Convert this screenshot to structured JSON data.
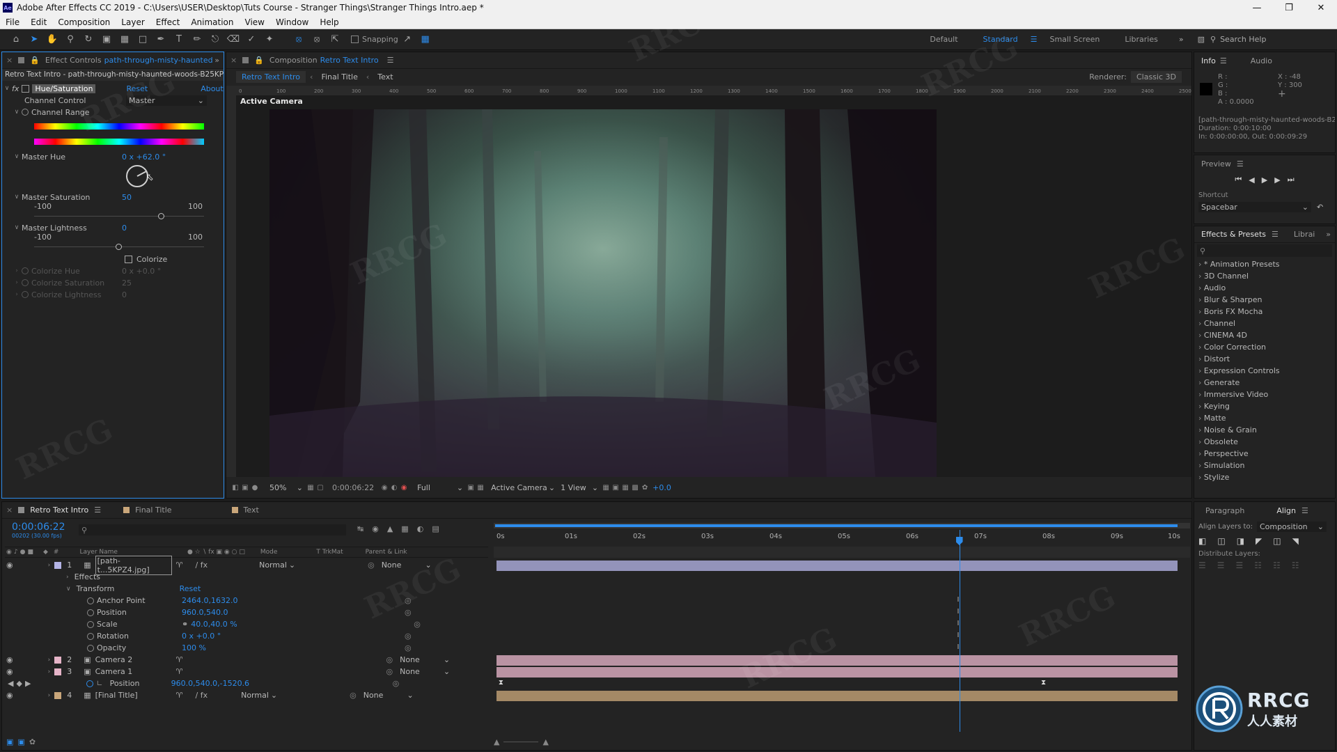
{
  "window": {
    "title": "Adobe After Effects CC 2019 - C:\\Users\\USER\\Desktop\\Tuts Course - Stranger Things\\Stranger Things Intro.aep *",
    "app_badge": "Ae"
  },
  "menu": [
    "File",
    "Edit",
    "Composition",
    "Layer",
    "Effect",
    "Animation",
    "View",
    "Window",
    "Help"
  ],
  "toolbar": {
    "snapping_label": "Snapping",
    "workspaces": [
      "Default",
      "Standard",
      "Small Screen",
      "Libraries"
    ],
    "active_workspace": "Standard",
    "search_help": "Search Help"
  },
  "effect_controls": {
    "tab_label": "Effect Controls",
    "tab_layer": "path-through-misty-haunted",
    "header": "Retro Text Intro - path-through-misty-haunted-woods-B25KPZ4",
    "effect_name": "Hue/Saturation",
    "reset": "Reset",
    "about": "About",
    "channel_control_label": "Channel Control",
    "channel_control_value": "Master",
    "channel_range_label": "Channel Range",
    "master_hue_label": "Master Hue",
    "master_hue_value": "0 x +62.0 °",
    "master_hue_deg": 62,
    "master_saturation_label": "Master Saturation",
    "master_saturation_value": "50",
    "master_saturation": 50,
    "master_lightness_label": "Master Lightness",
    "master_lightness_value": "0",
    "master_lightness": 0,
    "range_min": "-100",
    "range_max": "100",
    "colorize_label": "Colorize",
    "colorize_hue_label": "Colorize Hue",
    "colorize_hue_value": "0 x +0.0 °",
    "colorize_saturation_label": "Colorize Saturation",
    "colorize_saturation_value": "25",
    "colorize_lightness_label": "Colorize Lightness",
    "colorize_lightness_value": "0"
  },
  "composition": {
    "tab_label": "Composition",
    "tab_comp": "Retro Text Intro",
    "breadcrumbs": [
      "Retro Text Intro",
      "Final Title",
      "Text"
    ],
    "renderer_label": "Renderer:",
    "renderer_value": "Classic 3D",
    "active_camera_label": "Active Camera",
    "ruler_ticks": [
      "0",
      "100",
      "200",
      "300",
      "400",
      "500",
      "600",
      "700",
      "800",
      "900",
      "1000",
      "1100",
      "1200",
      "1300",
      "1400",
      "1500",
      "1600",
      "1700",
      "1800",
      "1900",
      "2000",
      "2100",
      "2200",
      "2300",
      "2400",
      "2500"
    ],
    "zoom": "50%",
    "timecode": "0:00:06:22",
    "resolution": "Full",
    "view_camera": "Active Camera",
    "view_layout": "1 View",
    "exposure": "+0.0"
  },
  "info_panel": {
    "tabs": [
      "Info",
      "Audio"
    ],
    "rgb_labels": [
      "R :",
      "G :",
      "B :",
      "A :"
    ],
    "alpha_value": "0.0000",
    "x_value": "X : -48",
    "y_value": "Y : 300",
    "layer_name": "[path-through-misty-haunted-woods-B2",
    "duration": "Duration: 0:00:10:00",
    "in_out": "In: 0:00:00:00, Out: 0:00:09:29"
  },
  "preview_panel": {
    "title": "Preview",
    "shortcut_label": "Shortcut",
    "shortcut_value": "Spacebar"
  },
  "effects_presets": {
    "tab_label": "Effects & Presets",
    "tab_libraries": "Librai",
    "items": [
      "* Animation Presets",
      "3D Channel",
      "Audio",
      "Blur & Sharpen",
      "Boris FX Mocha",
      "Channel",
      "CINEMA 4D",
      "Color Correction",
      "Distort",
      "Expression Controls",
      "Generate",
      "Immersive Video",
      "Keying",
      "Matte",
      "Noise & Grain",
      "Obsolete",
      "Perspective",
      "Simulation",
      "Stylize"
    ]
  },
  "align_panel": {
    "tabs": [
      "Paragraph",
      "Align"
    ],
    "align_to_label": "Align Layers to:",
    "align_to_value": "Composition",
    "distribute_label": "Distribute Layers:"
  },
  "timeline": {
    "tabs": [
      "Retro Text Intro",
      "Final Title",
      "Text"
    ],
    "timecode": "0:00:06:22",
    "fps_note": "00202 (30.00 fps)",
    "col_layer_name": "Layer Name",
    "col_mode": "Mode",
    "col_trkmat": "T  TrkMat",
    "col_parent": "Parent & Link",
    "time_labels": [
      "0s",
      "01s",
      "02s",
      "03s",
      "04s",
      "05s",
      "06s",
      "07s",
      "08s",
      "09s",
      "10s"
    ],
    "playhead_seconds": 6.73,
    "duration_seconds": 10,
    "layers": [
      {
        "num": "1",
        "name": "[path-t...5KPZ4.jpg]",
        "mode": "Normal",
        "parent": "None",
        "color": "#b4b4e6"
      },
      {
        "num": "2",
        "name": "Camera 2",
        "parent": "None",
        "color": "#e6b4c8"
      },
      {
        "num": "3",
        "name": "Camera 1",
        "parent": "None",
        "color": "#e6b4c8"
      },
      {
        "num": "4",
        "name": "[Final Title]",
        "mode": "Normal",
        "parent": "None",
        "color": "#c9a67a"
      }
    ],
    "effects_label": "Effects",
    "transform_label": "Transform",
    "transform_reset": "Reset",
    "properties": [
      {
        "name": "Anchor Point",
        "value": "2464.0,1632.0"
      },
      {
        "name": "Position",
        "value": "960.0,540.0"
      },
      {
        "name": "Scale",
        "value": "40.0,40.0 %"
      },
      {
        "name": "Rotation",
        "value": "0 x +0.0 °"
      },
      {
        "name": "Opacity",
        "value": "100 %"
      }
    ],
    "cam1_position_label": "Position",
    "cam1_position_value": "960.0,540.0,-1520.6"
  },
  "watermark": "RRCG",
  "logo": {
    "main": "RRCG",
    "sub": "人人素材"
  },
  "colors": {
    "accent": "#2d8ceb",
    "panel_bg": "#232323",
    "layer1": "#b4b4e6",
    "camera": "#e6b4c8",
    "precomp": "#c9a67a"
  }
}
